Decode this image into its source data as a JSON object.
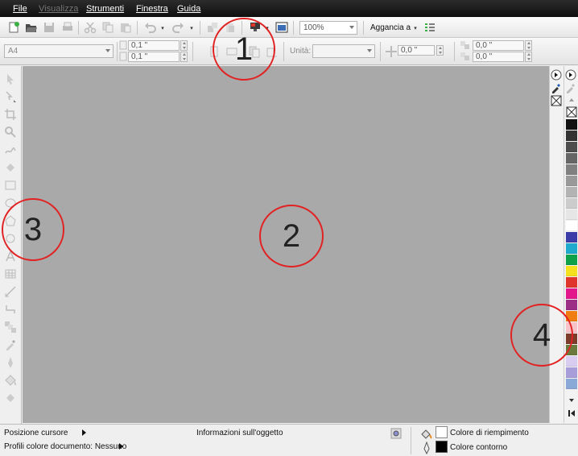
{
  "menu": [
    "File",
    "Visualizza",
    "Strumenti",
    "Finestra",
    "Guida"
  ],
  "toolbar": {
    "zoom_value": "100%",
    "snap_label": "Aggancia a"
  },
  "property_bar": {
    "page_size": "A4",
    "width_value": "0,1 \"",
    "height_value": "0,1 \"",
    "units_label": "Unità:",
    "units_value": "",
    "nudge_value": "0,0 \"",
    "dup_x_value": "0,0 \"",
    "dup_y_value": "0,0 \""
  },
  "status": {
    "cursor_position": "Posizione cursore",
    "color_profiles": "Profili colore documento: Nessuno",
    "object_info": "Informazioni sull'oggetto",
    "fill_label": "Colore di riempimento",
    "outline_label": "Colore contorno"
  },
  "annotations": [
    "1",
    "2",
    "3",
    "4"
  ],
  "colors": {
    "menubar_bg": "#1a1a1a",
    "canvas": "#a9a9a9",
    "annotation": "#e22222"
  },
  "palette": [
    "#111111",
    "#333333",
    "#4d4d4d",
    "#666666",
    "#808080",
    "#999999",
    "#b3b3b3",
    "#cccccc",
    "#e6e6e6",
    "#ffffff",
    "#3c3ca8",
    "#1eaacc",
    "#0fa04a",
    "#f5e01e",
    "#e0352a",
    "#e3168c",
    "#9b2f86",
    "#f07d12",
    "#f9c1c8",
    "#7d3c2a",
    "#6a7a3c",
    "#d8cdf0",
    "#a79dd8",
    "#8aa9d6"
  ]
}
